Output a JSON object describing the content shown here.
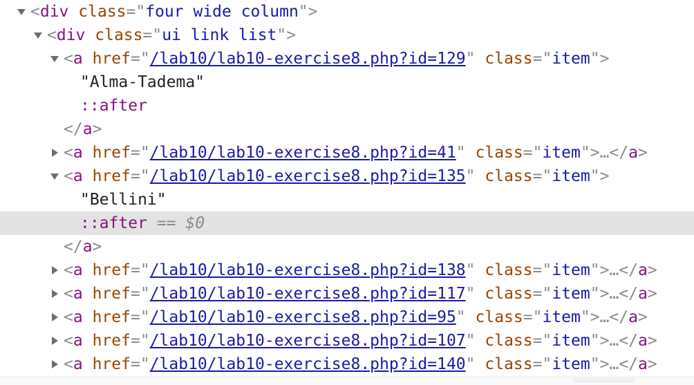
{
  "nodes": {
    "div_column": {
      "tag": "div",
      "attr": "class",
      "value": "four wide column"
    },
    "div_list": {
      "tag": "div",
      "attr": "class",
      "value": "ui link list"
    },
    "links": [
      {
        "href": "/lab10/lab10-exercise8.php?id=129",
        "class": "item",
        "expanded": true,
        "text": "\"Alma-Tadema\""
      },
      {
        "href": "/lab10/lab10-exercise8.php?id=41",
        "class": "item",
        "expanded": false
      },
      {
        "href": "/lab10/lab10-exercise8.php?id=135",
        "class": "item",
        "expanded": true,
        "text": "\"Bellini\""
      },
      {
        "href": "/lab10/lab10-exercise8.php?id=138",
        "class": "item",
        "expanded": false
      },
      {
        "href": "/lab10/lab10-exercise8.php?id=117",
        "class": "item",
        "expanded": false
      },
      {
        "href": "/lab10/lab10-exercise8.php?id=95",
        "class": "item",
        "expanded": false
      },
      {
        "href": "/lab10/lab10-exercise8.php?id=107",
        "class": "item",
        "expanded": false
      },
      {
        "href": "/lab10/lab10-exercise8.php?id=140",
        "class": "item",
        "expanded": false
      }
    ]
  },
  "tokens": {
    "lt": "<",
    "gt": ">",
    "lt_slash": "</",
    "eq": "=",
    "quote": "\"",
    "attr_class": "class",
    "attr_href": "href",
    "tag_a": "a",
    "ellipsis_close": ">…</",
    "pseudo_after": "::after",
    "selected_marker": "==",
    "console_var": "$0"
  },
  "colors": {
    "tag": "#881280",
    "attr_name": "#994500",
    "attr_value": "#1a1aa6",
    "punctuation": "#8a8a8a",
    "selected_row": "#e2e2e2"
  },
  "selected_node": "::after"
}
